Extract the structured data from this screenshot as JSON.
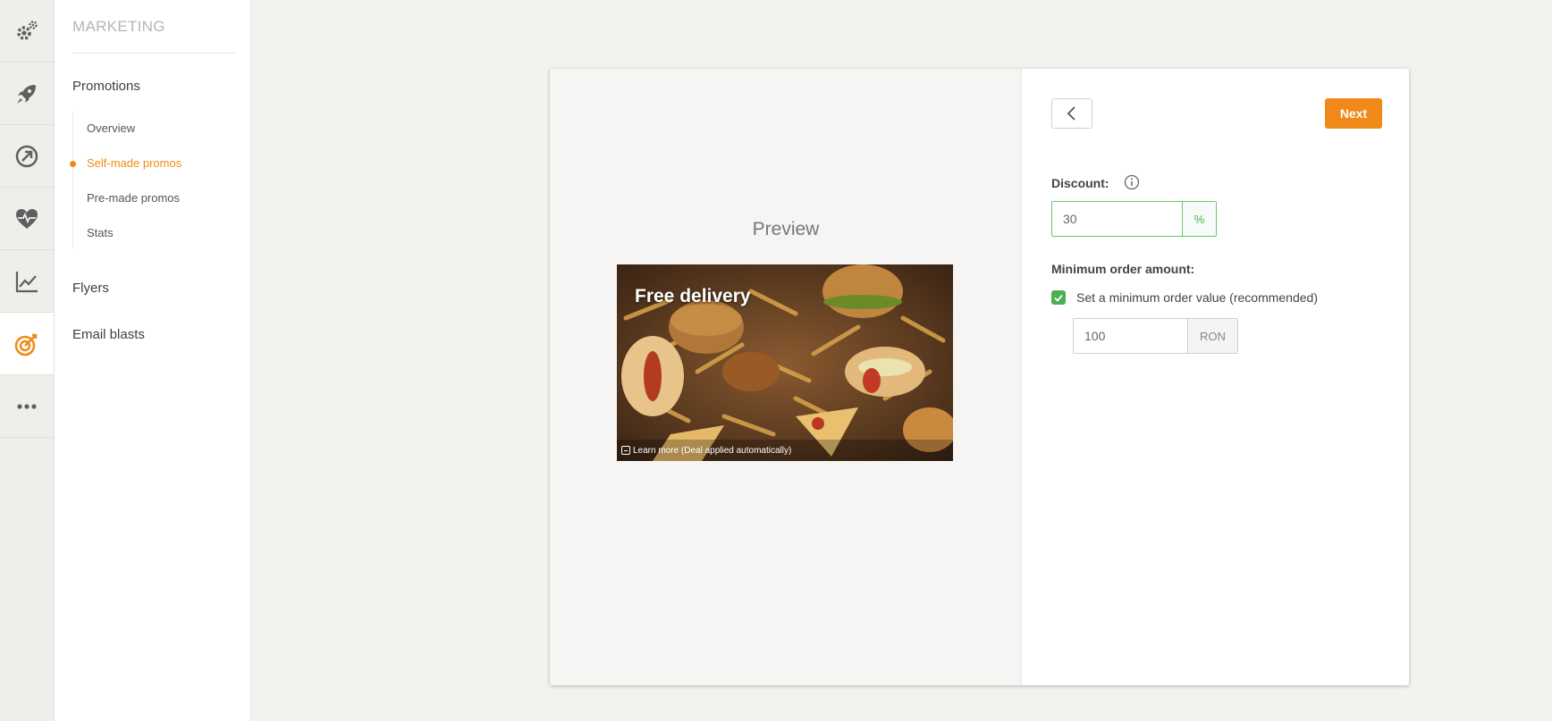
{
  "colors": {
    "accent": "#f08a15",
    "success": "#4caf50",
    "icon_gray": "#5f5f5f"
  },
  "rail": {
    "items": [
      {
        "icon": "gears-icon",
        "active": false
      },
      {
        "icon": "rocket-icon",
        "active": false
      },
      {
        "icon": "gauge-arrow-icon",
        "active": false
      },
      {
        "icon": "heart-pulse-icon",
        "active": false
      },
      {
        "icon": "line-chart-icon",
        "active": false
      },
      {
        "icon": "target-icon",
        "active": true
      },
      {
        "icon": "more-dots-icon",
        "active": false
      }
    ]
  },
  "nav": {
    "header": "MARKETING",
    "sections": [
      {
        "label": "Promotions"
      },
      {
        "label": "Flyers"
      },
      {
        "label": "Email blasts"
      }
    ],
    "sub_items": [
      {
        "label": "Overview",
        "active": false
      },
      {
        "label": "Self-made promos",
        "active": true
      },
      {
        "label": "Pre-made promos",
        "active": false
      },
      {
        "label": "Stats",
        "active": false
      }
    ]
  },
  "preview": {
    "title": "Preview",
    "headline": "Free delivery",
    "footer": "Learn more (Deal applied automatically)"
  },
  "form": {
    "next_label": "Next",
    "discount_label": "Discount:",
    "discount_value": "30",
    "discount_unit": "%",
    "min_order_label": "Minimum order amount:",
    "min_order_checkbox_label": "Set a minimum order value (recommended)",
    "min_order_checked": true,
    "min_order_value": "100",
    "currency": "RON"
  }
}
